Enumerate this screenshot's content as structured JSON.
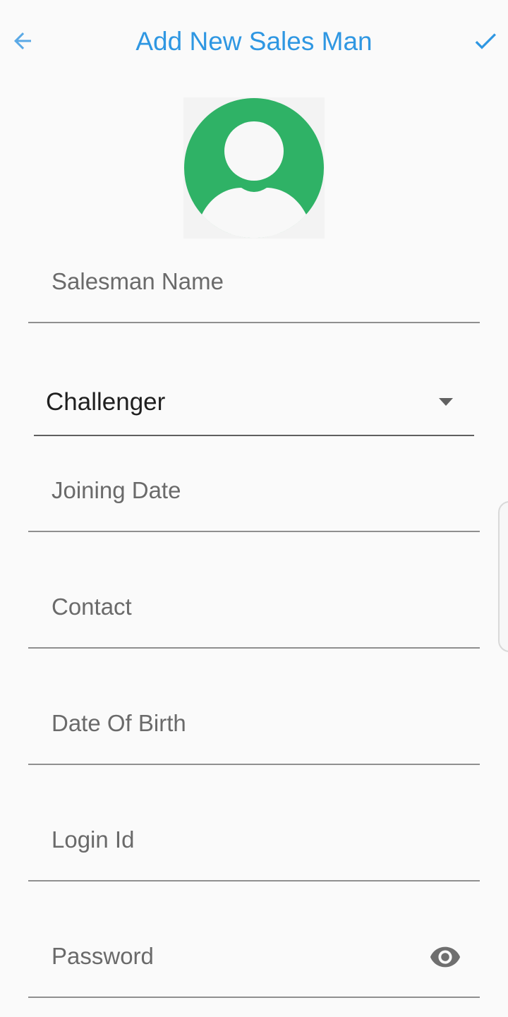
{
  "header": {
    "title": "Add New Sales Man",
    "back_icon": "arrow-back-icon",
    "save_icon": "check-icon"
  },
  "avatar": {
    "icon": "person-avatar-icon"
  },
  "form": {
    "salesman_name": {
      "placeholder": "Salesman Name",
      "value": ""
    },
    "category_dropdown": {
      "selected": "Challenger"
    },
    "joining_date": {
      "placeholder": "Joining Date",
      "value": ""
    },
    "contact": {
      "placeholder": "Contact",
      "value": ""
    },
    "date_of_birth": {
      "placeholder": "Date Of Birth",
      "value": ""
    },
    "login_id": {
      "placeholder": "Login Id",
      "value": ""
    },
    "password": {
      "placeholder": "Password",
      "value": "",
      "toggle_icon": "eye-icon"
    }
  },
  "colors": {
    "accent": "#2f97e2",
    "avatar_green": "#2fb266",
    "background": "#fafafa"
  }
}
